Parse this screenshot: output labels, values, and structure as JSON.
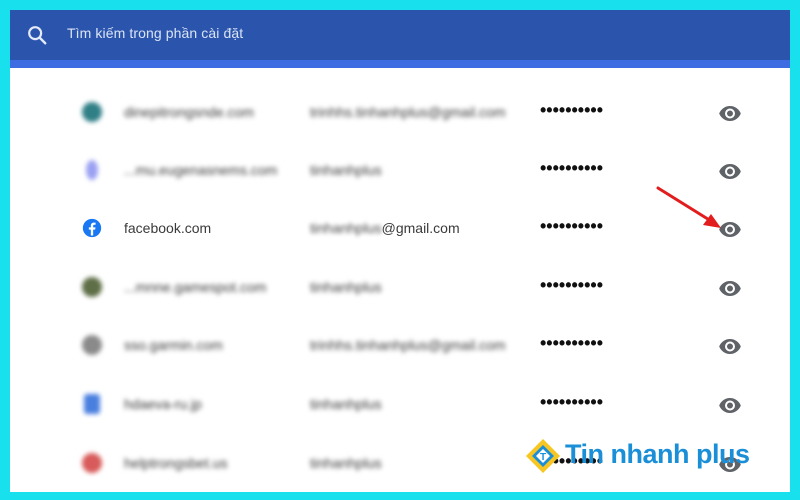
{
  "search": {
    "placeholder": "Tìm kiếm trong phần cài đặt"
  },
  "passwords": [
    {
      "site": "dinepitrongsnde.com",
      "user": "trinhhs.tinhanhplus@gmail.com",
      "password": "••••••••••",
      "icon_color": "#2f7f86",
      "blurred": true
    },
    {
      "site": "...mu.eugenasnems.com",
      "user": "tinhanhplus",
      "password": "••••••••••",
      "icon_color": "#9aa0f2",
      "blurred": true
    },
    {
      "site": "facebook.com",
      "user_blurred": "tinhanhplus",
      "user_visible": "@gmail.com",
      "password": "••••••••••",
      "icon_color": "#1877f2",
      "blurred": false
    },
    {
      "site": "...mnne.gamespot.com",
      "user": "tinhanhplus",
      "password": "••••••••••",
      "icon_color": "#5e6e46",
      "blurred": true
    },
    {
      "site": "sso.garmin.com",
      "user": "trinhhs.tinhanhplus@gmail.com",
      "password": "••••••••••",
      "icon_color": "#8a8a8a",
      "blurred": true
    },
    {
      "site": "hdaeva-ru.jp",
      "user": "tinhanhplus",
      "password": "••••••••••",
      "icon_color": "#4a7fe0",
      "blurred": true
    },
    {
      "site": "helptrongsbet.us",
      "user": "tinhanhplus",
      "password": "••••••••••",
      "icon_color": "#d85a5a",
      "blurred": true
    }
  ],
  "watermark": {
    "brand": "Tin nhanh plus"
  },
  "colors": {
    "frame_border": "#18e0ec",
    "header": "#2b55ad",
    "annotation_arrow": "#e21d1d",
    "brand": "#1a8fd8"
  }
}
